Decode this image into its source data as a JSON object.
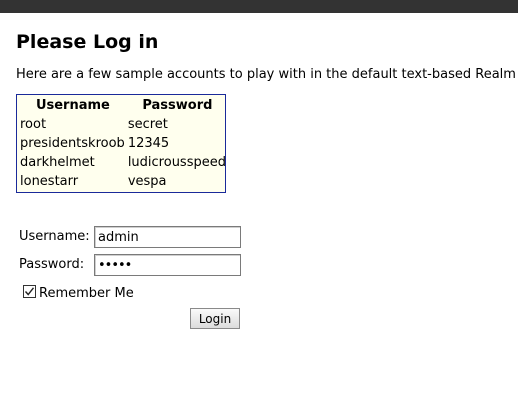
{
  "page": {
    "title": "Please Log in",
    "intro": "Here are a few sample accounts to play with in the default text-based Realm (u"
  },
  "accounts_table": {
    "headers": [
      "Username",
      "Password"
    ],
    "rows": [
      [
        "root",
        "secret"
      ],
      [
        "presidentskroob",
        "12345"
      ],
      [
        "darkhelmet",
        "ludicrousspeed"
      ],
      [
        "lonestarr",
        "vespa"
      ]
    ]
  },
  "form": {
    "username_label": "Username:",
    "username_value": "admin",
    "password_label": "Password:",
    "password_value": "•••••",
    "remember_label": "Remember Me",
    "remember_checked": true,
    "login_label": "Login"
  },
  "colors": {
    "topbar": "#333333",
    "table_background": "#ffffee",
    "table_border": "#1a2a9a"
  },
  "icons": {
    "checkbox_mark": "check-icon"
  }
}
